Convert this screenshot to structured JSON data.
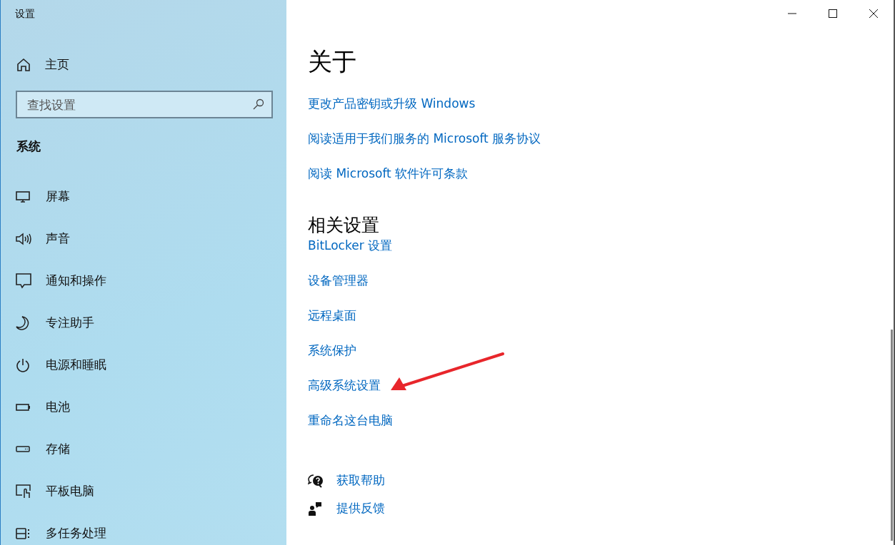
{
  "window": {
    "title": "设置"
  },
  "sidebar": {
    "home": "主页",
    "search": {
      "placeholder": "查找设置"
    },
    "section": "系统",
    "items": [
      {
        "label": "屏幕"
      },
      {
        "label": "声音"
      },
      {
        "label": "通知和操作"
      },
      {
        "label": "专注助手"
      },
      {
        "label": "电源和睡眠"
      },
      {
        "label": "电池"
      },
      {
        "label": "存储"
      },
      {
        "label": "平板电脑"
      },
      {
        "label": "多任务处理"
      }
    ]
  },
  "main": {
    "heading": "关于",
    "links": [
      "更改产品密钥或升级 Windows",
      "阅读适用于我们服务的 Microsoft 服务协议",
      "阅读 Microsoft 软件许可条款"
    ],
    "related_heading": "相关设置",
    "related_links": [
      "BitLocker 设置",
      "设备管理器",
      "远程桌面",
      "系统保护",
      "高级系统设置",
      "重命名这台电脑"
    ],
    "support": [
      {
        "label": "获取帮助"
      },
      {
        "label": "提供反馈"
      }
    ]
  }
}
